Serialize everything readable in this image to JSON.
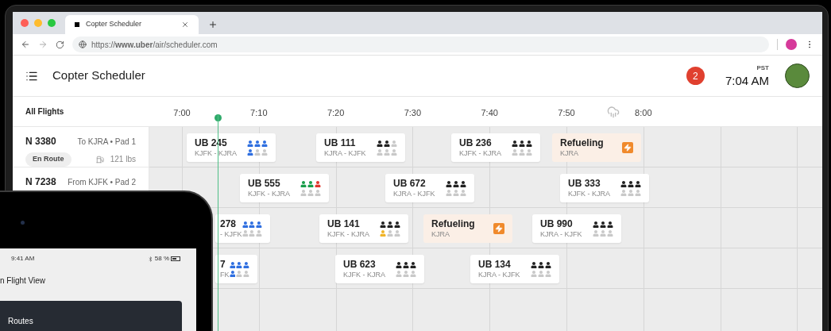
{
  "browser": {
    "tab_title": "Copter Scheduler",
    "url": "https://**www.uber**/air/scheduler.com"
  },
  "header": {
    "title": "Copter Scheduler",
    "notifications": "2",
    "timezone": "PST",
    "time": "7:04 AM"
  },
  "timeline": {
    "sidebar_heading": "All Flights",
    "times": [
      "7:00",
      "7:10",
      "7:20",
      "7:30",
      "7:40",
      "7:50",
      "8:00"
    ]
  },
  "aircraft": [
    {
      "tail": "N 3380",
      "route": "To KJRA • Pad 1",
      "status": "En Route",
      "fuel": "121 lbs"
    },
    {
      "tail": "N 7238",
      "route": "From KJFK • Pad 2"
    }
  ],
  "rows": [
    {
      "cards": [
        {
          "kind": "flight",
          "id": "UB 245",
          "route": "KJFK - KJRA",
          "seats": [
            {
              "color": "#2f6fe0"
            },
            {
              "color": "#2f6fe0"
            },
            {
              "color": "#2f6fe0"
            },
            {
              "color": "#2f6fe0"
            },
            {
              "color": "#c9c9c9"
            },
            {
              "color": "#c9c9c9"
            }
          ]
        },
        {
          "kind": "flight",
          "id": "UB 111",
          "route": "KJRA - KJFK",
          "seats": [
            {
              "color": "#222222"
            },
            {
              "color": "#222222"
            },
            {
              "color": "#c9c9c9"
            },
            {
              "color": "#c9c9c9"
            },
            {
              "color": "#c9c9c9"
            },
            {
              "color": "#c9c9c9"
            }
          ]
        },
        {
          "kind": "flight",
          "id": "UB 236",
          "route": "KJFK - KJRA",
          "seats": [
            {
              "color": "#222222"
            },
            {
              "color": "#222222"
            },
            {
              "color": "#222222"
            },
            {
              "color": "#c9c9c9"
            },
            {
              "color": "#c9c9c9"
            },
            {
              "color": "#c9c9c9"
            }
          ]
        },
        {
          "kind": "refuel",
          "label": "Refueling",
          "location": "KJRA"
        }
      ]
    },
    {
      "cards": [
        {
          "kind": "flight",
          "id": "UB 555",
          "route": "KJFK - KJRA",
          "seats": [
            {
              "color": "#1a9e4b"
            },
            {
              "color": "#1a9e4b"
            },
            {
              "color": "#e0362c"
            },
            {
              "color": "#c9c9c9"
            },
            {
              "color": "#c9c9c9"
            },
            {
              "color": "#c9c9c9"
            }
          ]
        },
        {
          "kind": "flight",
          "id": "UB 672",
          "route": "KJRA - KJFK",
          "seats": [
            {
              "color": "#222222"
            },
            {
              "color": "#222222"
            },
            {
              "color": "#222222"
            },
            {
              "color": "#c9c9c9"
            },
            {
              "color": "#c9c9c9"
            },
            {
              "color": "#c9c9c9"
            }
          ]
        },
        {
          "kind": "flight",
          "id": "UB 333",
          "route": "KJFK - KJRA",
          "seats": [
            {
              "color": "#222222"
            },
            {
              "color": "#222222"
            },
            {
              "color": "#222222"
            },
            {
              "color": "#c9c9c9"
            },
            {
              "color": "#c9c9c9"
            },
            {
              "color": "#c9c9c9"
            }
          ]
        }
      ]
    },
    {
      "cards": [
        {
          "kind": "flight",
          "id": "278",
          "route": "- KJFK",
          "seats": [
            {
              "color": "#2f6fe0"
            },
            {
              "color": "#2f6fe0"
            },
            {
              "color": "#2f6fe0"
            },
            {
              "color": "#c9c9c9"
            },
            {
              "color": "#c9c9c9"
            },
            {
              "color": "#c9c9c9"
            }
          ]
        },
        {
          "kind": "flight",
          "id": "UB 141",
          "route": "KJFK - KJRA",
          "seats": [
            {
              "color": "#222222"
            },
            {
              "color": "#222222"
            },
            {
              "color": "#222222"
            },
            {
              "color": "#f0b429"
            },
            {
              "color": "#c9c9c9"
            },
            {
              "color": "#c9c9c9"
            }
          ]
        },
        {
          "kind": "refuel",
          "label": "Refueling",
          "location": "KJRA"
        },
        {
          "kind": "flight",
          "id": "UB 990",
          "route": "KJRA - KJFK",
          "seats": [
            {
              "color": "#222222"
            },
            {
              "color": "#222222"
            },
            {
              "color": "#222222"
            },
            {
              "color": "#c9c9c9"
            },
            {
              "color": "#c9c9c9"
            },
            {
              "color": "#c9c9c9"
            }
          ]
        }
      ]
    },
    {
      "cards": [
        {
          "kind": "flight",
          "id": "7",
          "route": "FK",
          "seats": [
            {
              "color": "#2f6fe0"
            },
            {
              "color": "#2f6fe0"
            },
            {
              "color": "#2f6fe0"
            },
            {
              "color": "#2f6fe0"
            },
            {
              "color": "#c9c9c9"
            },
            {
              "color": "#c9c9c9"
            }
          ]
        },
        {
          "kind": "flight",
          "id": "UB 623",
          "route": "KJFK - KJRA",
          "seats": [
            {
              "color": "#222222"
            },
            {
              "color": "#222222"
            },
            {
              "color": "#222222"
            },
            {
              "color": "#c9c9c9"
            },
            {
              "color": "#c9c9c9"
            },
            {
              "color": "#c9c9c9"
            }
          ]
        },
        {
          "kind": "flight",
          "id": "UB 134",
          "route": "KJRA - KJFK",
          "seats": [
            {
              "color": "#222222"
            },
            {
              "color": "#222222"
            },
            {
              "color": "#222222"
            },
            {
              "color": "#c9c9c9"
            },
            {
              "color": "#c9c9c9"
            },
            {
              "color": "#c9c9c9"
            }
          ]
        }
      ]
    }
  ],
  "tablet": {
    "time": "9:41 AM",
    "battery": "58 %",
    "title": "n Flight View",
    "panel": "Routes"
  }
}
